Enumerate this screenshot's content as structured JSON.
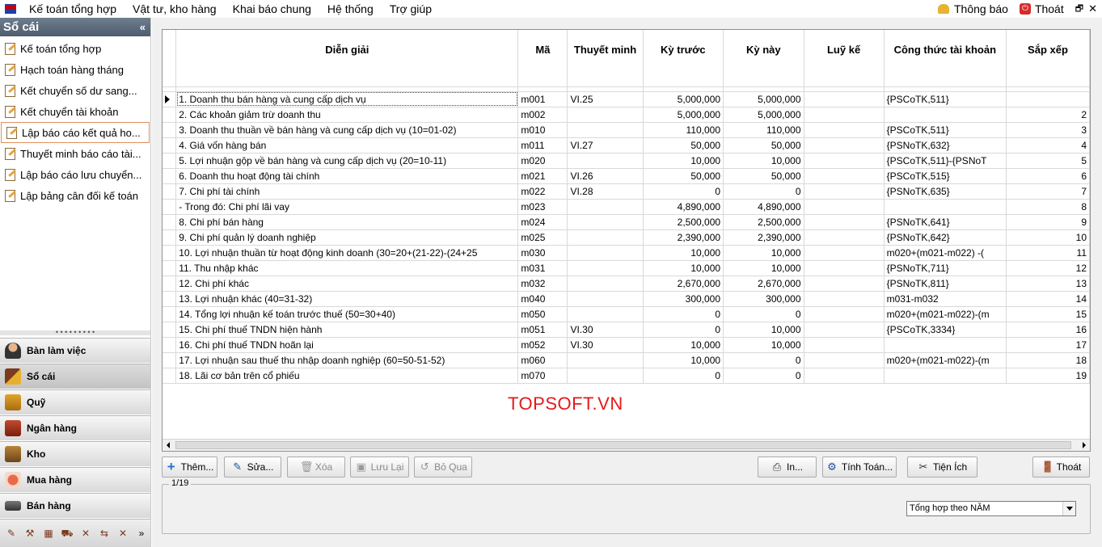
{
  "menu": {
    "items": [
      "Kế toán tổng hợp",
      "Vật tư, kho hàng",
      "Khai báo chung",
      "Hệ thống",
      "Trợ giúp"
    ],
    "notify_label": "Thông báo",
    "exit_label": "Thoát",
    "restore_glyph": "🗗",
    "close_glyph": "✕"
  },
  "sidebar": {
    "title": "Sổ cái",
    "collapse_glyph": "«",
    "items": [
      "Kế toán tổng hợp",
      "Hạch toán hàng tháng",
      "Kết chuyển số dư sang...",
      "Kết chuyển tài khoản",
      "Lập báo cáo kết quả ho...",
      "Thuyết minh báo cáo tài...",
      "Lập báo cáo lưu chuyển...",
      "Lập bảng cân đối kế toán"
    ],
    "active_index": 4,
    "splitter": "• • • • • • • • •",
    "nav": [
      "Bàn làm việc",
      "Sổ cái",
      "Quỹ",
      "Ngân hàng",
      "Kho",
      "Mua hàng",
      "Bán hàng"
    ],
    "nav_active": 1,
    "tools": [
      "✎",
      "⚒",
      "▦",
      "⛟",
      "✕",
      "⇆",
      "✕"
    ],
    "tools_more": "»"
  },
  "grid": {
    "columns": [
      "Diễn giải",
      "Mã",
      "Thuyết minh",
      "Kỳ trước",
      "Kỳ này",
      "Luỹ kế",
      "Công thức tài khoản",
      "Sắp xếp"
    ],
    "rows": [
      [
        "1. Doanh thu bán hàng và cung cấp dịch vụ",
        "m001",
        "VI.25",
        "5,000,000",
        "5,000,000",
        "",
        "{PSCoTK,511}",
        ""
      ],
      [
        "2. Các khoản giảm trừ doanh thu",
        "m002",
        "",
        "5,000,000",
        "5,000,000",
        "",
        "",
        "2"
      ],
      [
        "3. Doanh thu thuần về bán hàng và cung cấp dịch vụ (10=01-02)",
        "m010",
        "",
        "110,000",
        "110,000",
        "",
        "{PSCoTK,511}",
        "3"
      ],
      [
        "4. Giá vốn hàng bán",
        "m011",
        "VI.27",
        "50,000",
        "50,000",
        "",
        "{PSNoTK,632}",
        "4"
      ],
      [
        "5. Lợi nhuận gộp về bán hàng và cung cấp dịch vụ (20=10-11)",
        "m020",
        "",
        "10,000",
        "10,000",
        "",
        "{PSCoTK,511}-{PSNoT",
        "5"
      ],
      [
        "6. Doanh thu hoạt động tài chính",
        "m021",
        "VI.26",
        "50,000",
        "50,000",
        "",
        "{PSCoTK,515}",
        "6"
      ],
      [
        "7. Chi phí tài chính",
        "m022",
        "VI.28",
        "0",
        "0",
        "",
        "{PSNoTK,635}",
        "7"
      ],
      [
        "  - Trong đó: Chi phí lãi vay",
        "m023",
        "",
        "4,890,000",
        "4,890,000",
        "",
        "",
        "8"
      ],
      [
        "8. Chi phí bán hàng",
        "m024",
        "",
        "2,500,000",
        "2,500,000",
        "",
        "{PSNoTK,641}",
        "9"
      ],
      [
        "9. Chi phí quản lý doanh nghiệp",
        "m025",
        "",
        "2,390,000",
        "2,390,000",
        "",
        "{PSNoTK,642}",
        "10"
      ],
      [
        "10. Lợi nhuận thuần từ hoạt động kinh doanh (30=20+(21-22)-(24+25",
        "m030",
        "",
        "10,000",
        "10,000",
        "",
        "m020+(m021-m022) -(",
        "11"
      ],
      [
        "11. Thu nhập khác",
        "m031",
        "",
        "10,000",
        "10,000",
        "",
        "{PSNoTK,711}",
        "12"
      ],
      [
        "12. Chi phí khác",
        "m032",
        "",
        "2,670,000",
        "2,670,000",
        "",
        "{PSNoTK,811}",
        "13"
      ],
      [
        "13. Lợi nhuận khác (40=31-32)",
        "m040",
        "",
        "300,000",
        "300,000",
        "",
        "m031-m032",
        "14"
      ],
      [
        "14. Tổng lợi nhuận kế toán trước thuế (50=30+40)",
        "m050",
        "",
        "0",
        "0",
        "",
        "m020+(m021-m022)-(m",
        "15"
      ],
      [
        "15. Chi phí thuế TNDN hiện hành",
        "m051",
        "VI.30",
        "0",
        "10,000",
        "",
        "{PSCoTK,3334}",
        "16"
      ],
      [
        "16. Chi phí thuế TNDN hoãn lại",
        "m052",
        "VI.30",
        "10,000",
        "10,000",
        "",
        "",
        "17"
      ],
      [
        "17. Lợi nhuận sau thuế thu nhập doanh nghiệp (60=50-51-52)",
        "m060",
        "",
        "10,000",
        "0",
        "",
        "m020+(m021-m022)-(m",
        "18"
      ],
      [
        "18. Lãi cơ bản trên cổ phiếu",
        "m070",
        "",
        "0",
        "0",
        "",
        "",
        "19"
      ]
    ]
  },
  "watermark": "TOPSOFT.VN",
  "buttons": {
    "add": "Thêm...",
    "edit": "Sửa...",
    "delete": "Xóa",
    "save": "Lưu Lại",
    "cancel": "Bỏ Qua",
    "print": "In...",
    "calc": "Tính Toán...",
    "util": "Tiện Ích",
    "exit": "Thoát"
  },
  "record_counter": "1/19",
  "summary_select": "Tổng hợp theo NĂM"
}
